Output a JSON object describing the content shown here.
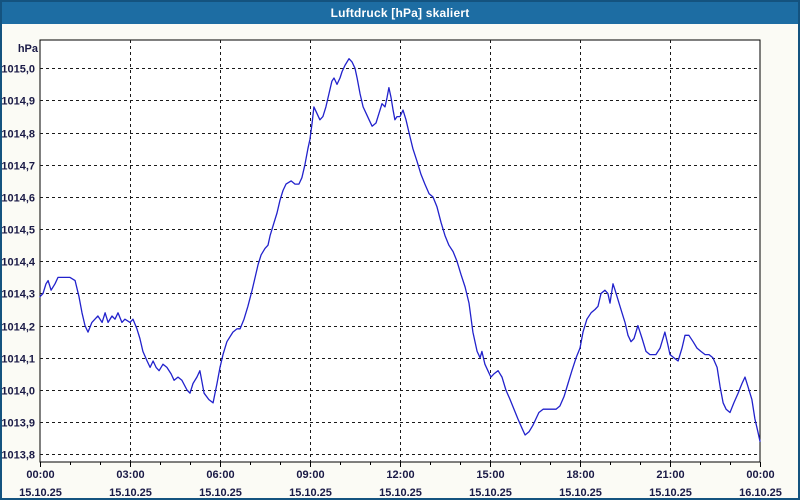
{
  "window": {
    "title": "Luftdruck [hPa] skaliert"
  },
  "chart_data": {
    "type": "line",
    "title": "Luftdruck [hPa] skaliert",
    "unit_label": "hPa",
    "xlabel": "",
    "ylabel": "hPa",
    "xlim": [
      0,
      24
    ],
    "ylim": [
      1013.776,
      1015.088
    ],
    "grid": "dashed",
    "legend": "none",
    "colors": {
      "titlebar_bg": "#1D6DA3",
      "titlebar_text": "#FFFFFF",
      "window_border": "#14537F",
      "window_bg": "#FBFBF5",
      "plot_bg": "#FFFFFF",
      "grid_line": "#1A1A1A",
      "axis_line": "#000000",
      "series_line": "#2222CC",
      "label_text": "#1A1A46"
    },
    "y_ticks": [
      {
        "value": 1015.0,
        "label": "1015,0"
      },
      {
        "value": 1014.9,
        "label": "1014,9"
      },
      {
        "value": 1014.8,
        "label": "1014,8"
      },
      {
        "value": 1014.7,
        "label": "1014,7"
      },
      {
        "value": 1014.6,
        "label": "1014,6"
      },
      {
        "value": 1014.5,
        "label": "1014,5"
      },
      {
        "value": 1014.4,
        "label": "1014,4"
      },
      {
        "value": 1014.3,
        "label": "1014,3"
      },
      {
        "value": 1014.2,
        "label": "1014,2"
      },
      {
        "value": 1014.1,
        "label": "1014,1"
      },
      {
        "value": 1014.0,
        "label": "1014,0"
      },
      {
        "value": 1013.9,
        "label": "1013,9"
      },
      {
        "value": 1013.8,
        "label": "1013,8"
      }
    ],
    "x_ticks": [
      {
        "hour": 0,
        "time": "00:00",
        "date": "15.10.25"
      },
      {
        "hour": 3,
        "time": "03:00",
        "date": "15.10.25"
      },
      {
        "hour": 6,
        "time": "06:00",
        "date": "15.10.25"
      },
      {
        "hour": 9,
        "time": "09:00",
        "date": "15.10.25"
      },
      {
        "hour": 12,
        "time": "12:00",
        "date": "15.10.25"
      },
      {
        "hour": 15,
        "time": "15:00",
        "date": "15.10.25"
      },
      {
        "hour": 18,
        "time": "18:00",
        "date": "15.10.25"
      },
      {
        "hour": 21,
        "time": "21:00",
        "date": "15.10.25"
      },
      {
        "hour": 24,
        "time": "00:00",
        "date": "16.10.25"
      }
    ],
    "minor_tick_every_hours": 1,
    "series": [
      {
        "name": "Luftdruck",
        "points": [
          [
            0.0,
            1014.29
          ],
          [
            0.1,
            1014.3
          ],
          [
            0.2,
            1014.33
          ],
          [
            0.27,
            1014.34
          ],
          [
            0.37,
            1014.31
          ],
          [
            0.5,
            1014.33
          ],
          [
            0.6,
            1014.35
          ],
          [
            0.8,
            1014.35
          ],
          [
            1.0,
            1014.35
          ],
          [
            1.17,
            1014.34
          ],
          [
            1.3,
            1014.29
          ],
          [
            1.4,
            1014.24
          ],
          [
            1.5,
            1014.2
          ],
          [
            1.6,
            1014.18
          ],
          [
            1.73,
            1014.21
          ],
          [
            1.83,
            1014.22
          ],
          [
            1.93,
            1014.23
          ],
          [
            2.07,
            1014.21
          ],
          [
            2.17,
            1014.24
          ],
          [
            2.27,
            1014.21
          ],
          [
            2.4,
            1014.23
          ],
          [
            2.5,
            1014.22
          ],
          [
            2.6,
            1014.24
          ],
          [
            2.73,
            1014.21
          ],
          [
            2.83,
            1014.22
          ],
          [
            3.0,
            1014.21
          ],
          [
            3.1,
            1014.22
          ],
          [
            3.23,
            1014.19
          ],
          [
            3.33,
            1014.16
          ],
          [
            3.43,
            1014.12
          ],
          [
            3.57,
            1014.09
          ],
          [
            3.67,
            1014.07
          ],
          [
            3.77,
            1014.09
          ],
          [
            3.87,
            1014.07
          ],
          [
            3.97,
            1014.06
          ],
          [
            4.1,
            1014.08
          ],
          [
            4.23,
            1014.07
          ],
          [
            4.37,
            1014.05
          ],
          [
            4.47,
            1014.03
          ],
          [
            4.6,
            1014.04
          ],
          [
            4.73,
            1014.03
          ],
          [
            4.9,
            1014.0
          ],
          [
            5.0,
            1013.99
          ],
          [
            5.1,
            1014.02
          ],
          [
            5.23,
            1014.04
          ],
          [
            5.33,
            1014.06
          ],
          [
            5.47,
            1013.99
          ],
          [
            5.63,
            1013.97
          ],
          [
            5.77,
            1013.96
          ],
          [
            5.9,
            1014.02
          ],
          [
            6.0,
            1014.07
          ],
          [
            6.1,
            1014.11
          ],
          [
            6.23,
            1014.15
          ],
          [
            6.43,
            1014.18
          ],
          [
            6.57,
            1014.19
          ],
          [
            6.67,
            1014.19
          ],
          [
            6.8,
            1014.22
          ],
          [
            6.93,
            1014.26
          ],
          [
            7.07,
            1014.31
          ],
          [
            7.17,
            1014.35
          ],
          [
            7.27,
            1014.39
          ],
          [
            7.37,
            1014.42
          ],
          [
            7.5,
            1014.44
          ],
          [
            7.6,
            1014.45
          ],
          [
            7.67,
            1014.48
          ],
          [
            7.8,
            1014.52
          ],
          [
            7.9,
            1014.55
          ],
          [
            8.0,
            1014.59
          ],
          [
            8.1,
            1014.62
          ],
          [
            8.2,
            1014.64
          ],
          [
            8.37,
            1014.65
          ],
          [
            8.5,
            1014.64
          ],
          [
            8.63,
            1014.64
          ],
          [
            8.73,
            1014.66
          ],
          [
            8.83,
            1014.7
          ],
          [
            8.93,
            1014.75
          ],
          [
            9.0,
            1014.78
          ],
          [
            9.07,
            1014.83
          ],
          [
            9.13,
            1014.88
          ],
          [
            9.23,
            1014.86
          ],
          [
            9.33,
            1014.84
          ],
          [
            9.43,
            1014.85
          ],
          [
            9.53,
            1014.88
          ],
          [
            9.63,
            1014.92
          ],
          [
            9.73,
            1014.96
          ],
          [
            9.8,
            1014.97
          ],
          [
            9.9,
            1014.95
          ],
          [
            10.0,
            1014.97
          ],
          [
            10.07,
            1014.99
          ],
          [
            10.17,
            1015.01
          ],
          [
            10.3,
            1015.03
          ],
          [
            10.4,
            1015.02
          ],
          [
            10.5,
            1015.0
          ],
          [
            10.57,
            1014.97
          ],
          [
            10.67,
            1014.92
          ],
          [
            10.77,
            1014.88
          ],
          [
            10.87,
            1014.86
          ],
          [
            10.97,
            1014.84
          ],
          [
            11.07,
            1014.82
          ],
          [
            11.2,
            1014.83
          ],
          [
            11.3,
            1014.86
          ],
          [
            11.4,
            1014.89
          ],
          [
            11.5,
            1014.88
          ],
          [
            11.57,
            1014.91
          ],
          [
            11.63,
            1014.94
          ],
          [
            11.7,
            1014.91
          ],
          [
            11.77,
            1014.87
          ],
          [
            11.83,
            1014.84
          ],
          [
            11.9,
            1014.85
          ],
          [
            12.0,
            1014.85
          ],
          [
            12.1,
            1014.87
          ],
          [
            12.2,
            1014.84
          ],
          [
            12.3,
            1014.8
          ],
          [
            12.43,
            1014.75
          ],
          [
            12.57,
            1014.71
          ],
          [
            12.7,
            1014.67
          ],
          [
            12.83,
            1014.64
          ],
          [
            12.97,
            1014.61
          ],
          [
            13.1,
            1014.6
          ],
          [
            13.23,
            1014.57
          ],
          [
            13.37,
            1014.52
          ],
          [
            13.5,
            1014.48
          ],
          [
            13.63,
            1014.45
          ],
          [
            13.77,
            1014.43
          ],
          [
            13.9,
            1014.4
          ],
          [
            14.03,
            1014.36
          ],
          [
            14.17,
            1014.32
          ],
          [
            14.3,
            1014.27
          ],
          [
            14.43,
            1014.18
          ],
          [
            14.57,
            1014.12
          ],
          [
            14.67,
            1014.1
          ],
          [
            14.73,
            1014.12
          ],
          [
            14.83,
            1014.08
          ],
          [
            14.93,
            1014.06
          ],
          [
            15.03,
            1014.04
          ],
          [
            15.13,
            1014.05
          ],
          [
            15.27,
            1014.06
          ],
          [
            15.4,
            1014.04
          ],
          [
            15.53,
            1014.0
          ],
          [
            15.67,
            1013.97
          ],
          [
            15.8,
            1013.94
          ],
          [
            15.93,
            1013.91
          ],
          [
            16.07,
            1013.88
          ],
          [
            16.17,
            1013.86
          ],
          [
            16.3,
            1013.87
          ],
          [
            16.43,
            1013.89
          ],
          [
            16.53,
            1013.91
          ],
          [
            16.63,
            1013.93
          ],
          [
            16.77,
            1013.94
          ],
          [
            17.0,
            1013.94
          ],
          [
            17.2,
            1013.94
          ],
          [
            17.33,
            1013.95
          ],
          [
            17.47,
            1013.98
          ],
          [
            17.6,
            1014.02
          ],
          [
            17.73,
            1014.06
          ],
          [
            17.87,
            1014.1
          ],
          [
            18.0,
            1014.13
          ],
          [
            18.1,
            1014.18
          ],
          [
            18.23,
            1014.22
          ],
          [
            18.37,
            1014.24
          ],
          [
            18.5,
            1014.25
          ],
          [
            18.6,
            1014.26
          ],
          [
            18.7,
            1014.3
          ],
          [
            18.83,
            1014.31
          ],
          [
            18.93,
            1014.3
          ],
          [
            19.0,
            1014.27
          ],
          [
            19.1,
            1014.33
          ],
          [
            19.17,
            1014.31
          ],
          [
            19.3,
            1014.27
          ],
          [
            19.4,
            1014.24
          ],
          [
            19.5,
            1014.21
          ],
          [
            19.6,
            1014.17
          ],
          [
            19.7,
            1014.15
          ],
          [
            19.8,
            1014.16
          ],
          [
            19.93,
            1014.2
          ],
          [
            20.07,
            1014.16
          ],
          [
            20.2,
            1014.12
          ],
          [
            20.33,
            1014.11
          ],
          [
            20.53,
            1014.11
          ],
          [
            20.67,
            1014.13
          ],
          [
            20.83,
            1014.18
          ],
          [
            20.93,
            1014.14
          ],
          [
            21.0,
            1014.11
          ],
          [
            21.13,
            1014.1
          ],
          [
            21.27,
            1014.09
          ],
          [
            21.4,
            1014.13
          ],
          [
            21.5,
            1014.17
          ],
          [
            21.63,
            1014.17
          ],
          [
            21.77,
            1014.15
          ],
          [
            21.9,
            1014.13
          ],
          [
            22.03,
            1014.12
          ],
          [
            22.17,
            1014.11
          ],
          [
            22.3,
            1014.11
          ],
          [
            22.43,
            1014.1
          ],
          [
            22.57,
            1014.07
          ],
          [
            22.67,
            1014.01
          ],
          [
            22.77,
            1013.96
          ],
          [
            22.87,
            1013.94
          ],
          [
            23.0,
            1013.93
          ],
          [
            23.13,
            1013.96
          ],
          [
            23.27,
            1013.99
          ],
          [
            23.4,
            1014.02
          ],
          [
            23.5,
            1014.04
          ],
          [
            23.6,
            1014.01
          ],
          [
            23.73,
            1013.97
          ],
          [
            23.83,
            1013.91
          ],
          [
            23.93,
            1013.87
          ],
          [
            24.0,
            1013.84
          ]
        ]
      }
    ]
  }
}
